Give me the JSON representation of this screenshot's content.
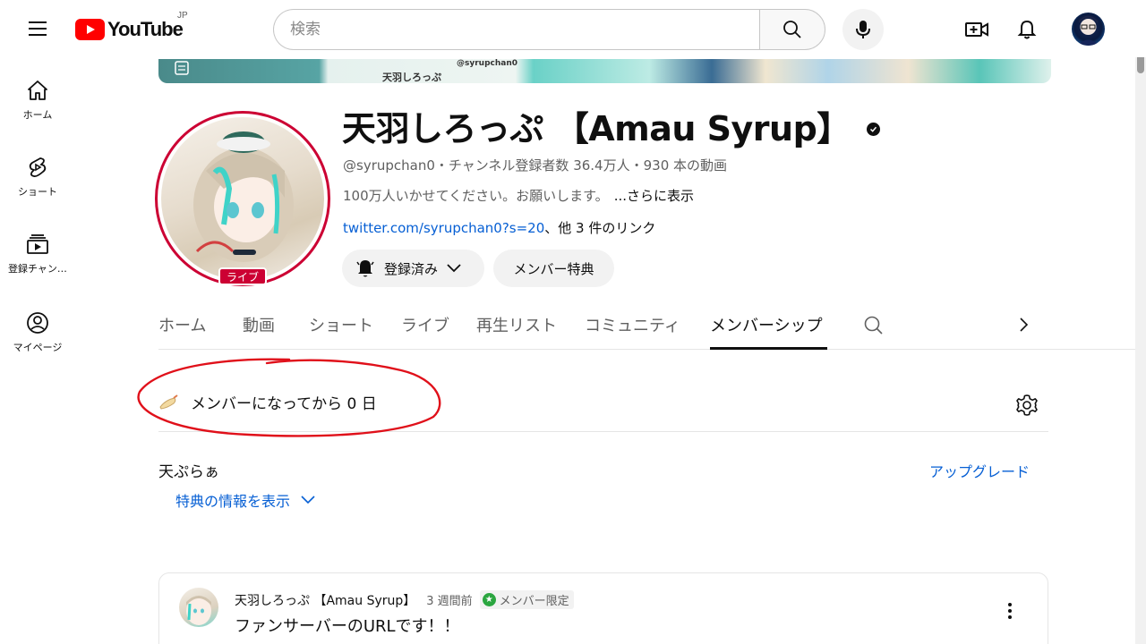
{
  "header": {
    "logo_text": "YouTube",
    "region": "JP",
    "search_placeholder": "検索"
  },
  "sidebar": {
    "items": [
      {
        "label": "ホーム",
        "icon": "home-icon"
      },
      {
        "label": "ショート",
        "icon": "shorts-icon"
      },
      {
        "label": "登録チャン…",
        "icon": "subscriptions-icon"
      },
      {
        "label": "マイページ",
        "icon": "account-icon"
      }
    ]
  },
  "banner": {
    "text_1": "@syrupchan0",
    "text_2": "天羽しろっぷ"
  },
  "channel": {
    "name": "天羽しろっぷ 【Amau Syrup】",
    "live_badge": "ライブ",
    "meta": "@syrupchan0・チャンネル登録者数 36.4万人・930 本の動画",
    "description": "100万人いかせてください。お願いします。",
    "more": "...さらに表示",
    "link": "twitter.com/syrupchan0?s=20",
    "link_extra": "、他 3 件のリンク",
    "subscribe_label": "登録済み",
    "perks_label": "メンバー特典"
  },
  "tabs": [
    {
      "label": "ホーム"
    },
    {
      "label": "動画"
    },
    {
      "label": "ショート"
    },
    {
      "label": "ライブ"
    },
    {
      "label": "再生リスト"
    },
    {
      "label": "コミュニティ"
    },
    {
      "label": "メンバーシップ"
    }
  ],
  "membership": {
    "days_text": "メンバーになってから 0 日",
    "tier_name": "天ぷらぁ",
    "upgrade_label": "アップグレード",
    "show_perks_label": "特典の情報を表示"
  },
  "post": {
    "author": "天羽しろっぷ 【Amau Syrup】",
    "time": "3 週間前",
    "badge": "メンバー限定",
    "body": "ファンサーバーのURLです！！"
  },
  "colors": {
    "brand_red": "#ff0000",
    "link_blue": "#065fd4",
    "annotation_red": "#e0101a",
    "live_red": "#cc0033",
    "member_green": "#2ba640"
  }
}
